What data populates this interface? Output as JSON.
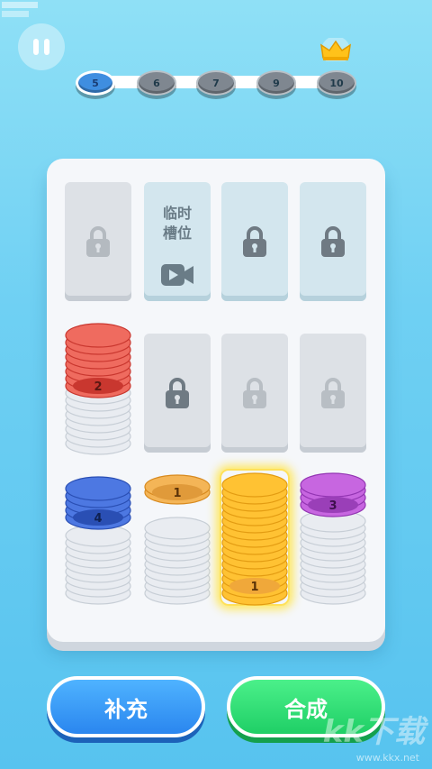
{
  "watermark_top": "",
  "levels": [
    {
      "label": "5",
      "state": "active"
    },
    {
      "label": "6",
      "state": "locked"
    },
    {
      "label": "7",
      "state": "locked"
    },
    {
      "label": "9",
      "state": "locked"
    },
    {
      "label": "10",
      "state": "locked"
    }
  ],
  "temp_slot": {
    "label_line1": "临时",
    "label_line2": "槽位"
  },
  "stacks": [
    {
      "top_number": "2",
      "color": "#e8574e",
      "dark": "#c9372f"
    },
    {
      "top_number": "4",
      "color": "#3f6ad8",
      "dark": "#2a4fb4"
    },
    {
      "top_number": "1",
      "color": "#f2a843",
      "dark": "#d88a1f"
    },
    {
      "top_number": "1",
      "color": "#ffc233",
      "dark": "#e39c12"
    },
    {
      "top_number": "3",
      "color": "#bb55d6",
      "dark": "#9335b3"
    }
  ],
  "buttons": {
    "refill": "补充",
    "merge": "合成"
  },
  "colors": {
    "accent_blue": "#2a86ef",
    "accent_green": "#1fcf66"
  },
  "watermark_bottom": {
    "logo": "kk下载",
    "url": "www.kkx.net"
  }
}
